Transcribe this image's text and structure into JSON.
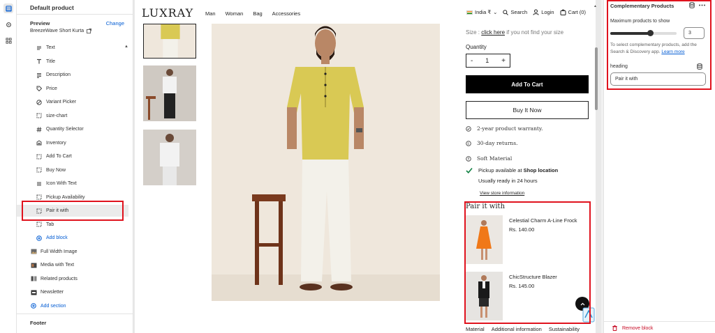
{
  "sidebar": {
    "title": "Default product",
    "preview_label": "Preview",
    "change_label": "Change",
    "preview_product": "BreezeWave Short Kurta",
    "blocks": [
      {
        "label": "Text",
        "icon": "text-icon"
      },
      {
        "label": "Title",
        "icon": "title-icon"
      },
      {
        "label": "Description",
        "icon": "description-icon"
      },
      {
        "label": "Price",
        "icon": "price-tag-icon"
      },
      {
        "label": "Variant Picker",
        "icon": "variant-icon"
      },
      {
        "label": "size-chart",
        "icon": "block-icon"
      },
      {
        "label": "Quantity Selector",
        "icon": "hash-icon"
      },
      {
        "label": "Inventory",
        "icon": "inventory-icon"
      },
      {
        "label": "Add To Cart",
        "icon": "block-icon"
      },
      {
        "label": "Buy Now",
        "icon": "block-icon"
      },
      {
        "label": "Icon With Text",
        "icon": "list-icon"
      },
      {
        "label": "Pickup Availability",
        "icon": "block-icon"
      },
      {
        "label": "Pair it with",
        "icon": "block-icon"
      },
      {
        "label": "Tab",
        "icon": "block-icon"
      }
    ],
    "add_block": "Add block",
    "sections": [
      {
        "label": "Full Width Image",
        "icon": "image-icon"
      },
      {
        "label": "Media with Text",
        "icon": "media-icon"
      },
      {
        "label": "Related products",
        "icon": "products-icon"
      },
      {
        "label": "Newsletter",
        "icon": "newsletter-icon"
      }
    ],
    "add_section": "Add section",
    "footer_label": "Footer"
  },
  "store": {
    "logo": "LUXRAY",
    "nav": [
      "Man",
      "Woman",
      "Bag",
      "Accessories"
    ],
    "country": "India ₹",
    "search": "Search",
    "login": "Login",
    "cart": "Cart (0)"
  },
  "product": {
    "size_prefix": "Size :",
    "size_link": "click here",
    "size_suffix": "if you not find your size",
    "quantity_label": "Quantity",
    "qty_minus": "-",
    "qty_value": "1",
    "qty_plus": "+",
    "add_to_cart": "Add To Cart",
    "buy_now": "Buy It Now",
    "features": [
      "2-year product warranty.",
      "30-day returns.",
      "Soft Material"
    ],
    "pickup_prefix": "Pickup available at",
    "pickup_location": "Shop location",
    "pickup_ready": "Usually ready in 24 hours",
    "view_store": "View store information",
    "tabs": [
      "Material",
      "Additional information",
      "Sustainability"
    ]
  },
  "pair": {
    "title": "Pair it with",
    "items": [
      {
        "name": "Celestial Charm A-Line Frock",
        "price": "Rs. 140.00",
        "color": "#f07818"
      },
      {
        "name": "ChicStructure Blazer",
        "price": "Rs. 145.00",
        "color": "#1a1a1a"
      }
    ]
  },
  "panel": {
    "title": "Complementary Products",
    "max_label": "Maximum products to show",
    "max_value": "3",
    "max_fraction": 0.6,
    "help_text": "To select complementary products, add the Search & Discovery app.",
    "help_link": "Learn more",
    "heading_label": "heading",
    "heading_value": "Pair it with",
    "remove": "Remove block"
  },
  "colors": {
    "accent": "#005bd3",
    "annotation": "#e0121d",
    "shirt": "#d9c954",
    "danger": "#c70a24"
  }
}
